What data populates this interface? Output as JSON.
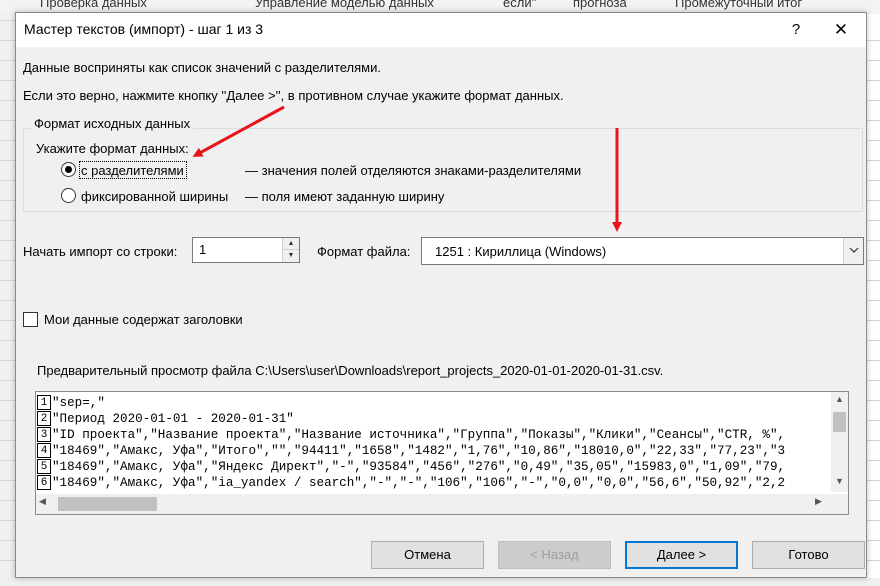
{
  "background": {
    "ribbon_items": [
      "Проверка данных",
      "Управление моделью данных",
      "если\"",
      "прогноза",
      "Промежуточный итог"
    ]
  },
  "dialog": {
    "title": "Мастер текстов (импорт) - шаг 1 из 3",
    "help_label": "?",
    "close_label": "✕",
    "intro_line1": "Данные восприняты как список значений с разделителями.",
    "intro_line2": "Если это верно, нажмите кнопку ''Далее >'', в противном случае укажите формат данных.",
    "source_format_group": {
      "legend": "Формат исходных данных",
      "prompt": "Укажите формат данных:",
      "options": [
        {
          "label": "с разделителями",
          "description": "— значения полей отделяются знаками-разделителями",
          "checked": true
        },
        {
          "label": "фиксированной ширины",
          "description": "— поля имеют заданную ширину",
          "checked": false
        }
      ]
    },
    "start_row_label": "Начать импорт со строки:",
    "start_row_value": "1",
    "file_format_label": "Формат файла:",
    "file_format_value": "1251 : Кириллица (Windows)",
    "headers_checkbox_label": "Мои данные содержат заголовки",
    "headers_checked": false,
    "preview_label": "Предварительный просмотр файла C:\\Users\\user\\Downloads\\report_projects_2020-01-01-2020-01-31.csv.",
    "preview_lines": [
      {
        "num": "1",
        "text": "\"sep=,\""
      },
      {
        "num": "2",
        "text": "\"Период 2020-01-01 - 2020-01-31\""
      },
      {
        "num": "3",
        "text": "\"ID проекта\",\"Название проекта\",\"Название источника\",\"Группа\",\"Показы\",\"Клики\",\"Сеансы\",\"CTR, %\","
      },
      {
        "num": "4",
        "text": "\"18469\",\"Амакс, Уфа\",\"Итого\",\"\",\"94411\",\"1658\",\"1482\",\"1,76\",\"10,86\",\"18010,0\",\"22,33\",\"77,23\",\"3"
      },
      {
        "num": "5",
        "text": "\"18469\",\"Амакс, Уфа\",\"Яндекс Директ\",\"-\",\"93584\",\"456\",\"276\",\"0,49\",\"35,05\",\"15983,0\",\"1,09\",\"79,"
      },
      {
        "num": "6",
        "text": "\"18469\",\"Амакс, Уфа\",\"ia_yandex / search\",\"-\",\"-\",\"106\",\"106\",\"-\",\"0,0\",\"0,0\",\"56,6\",\"50,92\",\"2,2"
      }
    ],
    "buttons": {
      "cancel": "Отмена",
      "back": "< Назад",
      "next": "Далее >",
      "finish": "Готово"
    }
  },
  "colors": {
    "annotation_arrow": "#e8141b",
    "default_button_border": "#0078d7"
  }
}
